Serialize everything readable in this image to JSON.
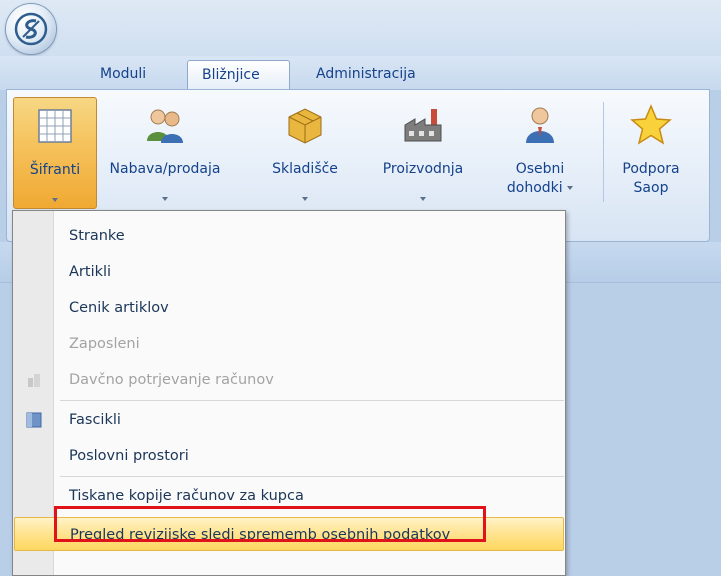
{
  "tabs": [
    {
      "label": "Moduli"
    },
    {
      "label": "Bližnjice"
    },
    {
      "label": "Administracija"
    }
  ],
  "ribbon": {
    "buttons": [
      {
        "label": "Šifranti",
        "icon": "grid-table-icon"
      },
      {
        "label": "Nabava/prodaja",
        "icon": "people-icon"
      },
      {
        "label": "Skladišče",
        "icon": "boxes-icon"
      },
      {
        "label": "Proizvodnja",
        "icon": "factory-icon"
      },
      {
        "label": "Osebni",
        "label2": "dohodki",
        "icon": "person-icon"
      },
      {
        "label": "Podpora",
        "label2": "Saop",
        "icon": "star-icon"
      }
    ]
  },
  "menu": {
    "items": [
      {
        "label": "Stranke",
        "enabled": true
      },
      {
        "label": "Artikli",
        "enabled": true
      },
      {
        "label": "Cenik artiklov",
        "enabled": true
      },
      {
        "label": "Zaposleni",
        "enabled": false
      },
      {
        "label": "Davčno potrjevanje računov",
        "enabled": false,
        "icon": "building-icon"
      },
      {
        "label": "Fascikli",
        "enabled": true,
        "icon": "folder-icon"
      },
      {
        "label": "Poslovni prostori",
        "enabled": true
      },
      {
        "label": "Tiskane kopije računov za kupca",
        "enabled": true
      },
      {
        "label": "Pregled revizijske sledi sprememb osebnih podatkov",
        "enabled": true,
        "highlighted": true
      }
    ]
  },
  "colors": {
    "accent": "#15428b",
    "pressed": "#f5c15a",
    "highlight_box": "#e0131a"
  }
}
